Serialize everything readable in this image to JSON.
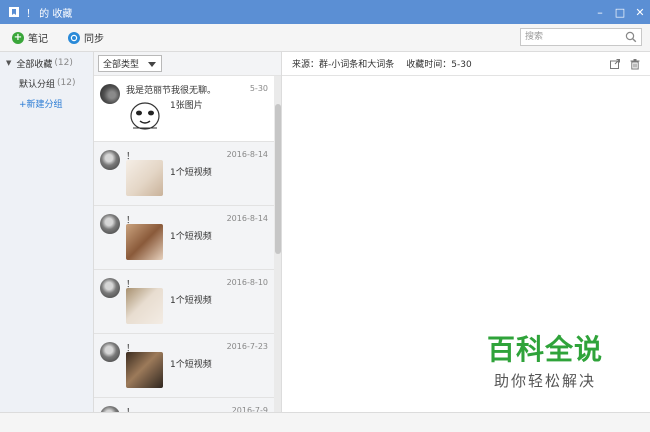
{
  "window": {
    "title": "！ 的 收藏",
    "minimize": "–",
    "maximize": "□",
    "close": "✕",
    "accent": "#5b8fd4"
  },
  "toolbar": {
    "note_label": "笔记",
    "sync_label": "同步",
    "search_placeholder": "搜索"
  },
  "sidebar": {
    "root": {
      "label": "全部收藏",
      "count": "(12)"
    },
    "group": {
      "label": "默认分组",
      "count": "(12)"
    },
    "new_group": "+新建分组"
  },
  "filter": {
    "selected": "全部类型"
  },
  "list": [
    {
      "title": "我是范丽节我很无聊。",
      "date": "5-30",
      "desc": "1张图片"
    },
    {
      "title": "！",
      "date": "2016-8-14",
      "desc": "1个短视频"
    },
    {
      "title": "！",
      "date": "2016-8-14",
      "desc": "1个短视频"
    },
    {
      "title": "！",
      "date": "2016-8-10",
      "desc": "1个短视频"
    },
    {
      "title": "！",
      "date": "2016-7-23",
      "desc": "1个短视频"
    },
    {
      "title": "！",
      "date": "2016-7-9"
    }
  ],
  "detail": {
    "source": "来源：群-小词条和大词条",
    "time": "收藏时间：5-30"
  },
  "watermark": {
    "big": "百科全说",
    "small": "助你轻松解决"
  }
}
